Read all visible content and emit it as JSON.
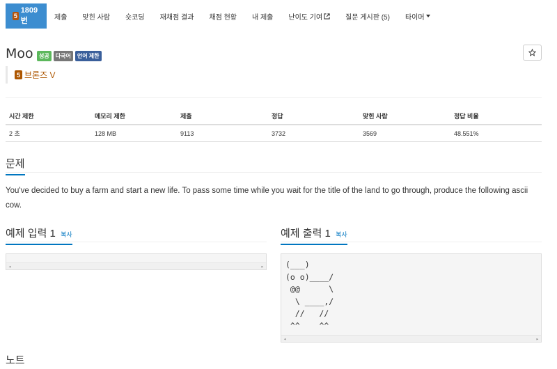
{
  "nav": {
    "active": {
      "badge": "5",
      "label": "1809번"
    },
    "items": [
      "제출",
      "맞힌 사람",
      "숏코딩",
      "재채점 결과",
      "채점 현황",
      "내 제출",
      "난이도 기여",
      "질문 게시판 (5)",
      "타이머"
    ],
    "icons": {
      "contribute": "external-link-icon",
      "timer": "caret-down-icon"
    }
  },
  "problem": {
    "title": "Moo",
    "labels": [
      "성공",
      "다국어",
      "언어 제한"
    ],
    "star_icon": "star-icon",
    "tier": {
      "badge": "5",
      "name": "브론즈 V"
    }
  },
  "stats": {
    "headers": [
      "시간 제한",
      "메모리 제한",
      "제출",
      "정답",
      "맞힌 사람",
      "정답 비율"
    ],
    "values": [
      "2 초",
      "128 MB",
      "9113",
      "3732",
      "3569",
      "48.551%"
    ]
  },
  "sections": {
    "problem_heading": "문제",
    "description": "You've decided to buy a farm and start a new life. To pass some time while you wait for the title of the land to go through, produce the following ascii cow.",
    "input_heading": "예제 입력",
    "input_num": "1",
    "output_heading": "예제 출력",
    "output_num": "1",
    "copy_label": "복사",
    "sample_input": "",
    "sample_output": "(___)\n(o o)____/\n @@      \\\n  \\ ____,/\n  //   //\n ^^    ^^",
    "note_heading": "노트"
  },
  "colors": {
    "accent": "#0076c0",
    "nav_active": "#3c8dd0",
    "bronze": "#ad5600"
  }
}
